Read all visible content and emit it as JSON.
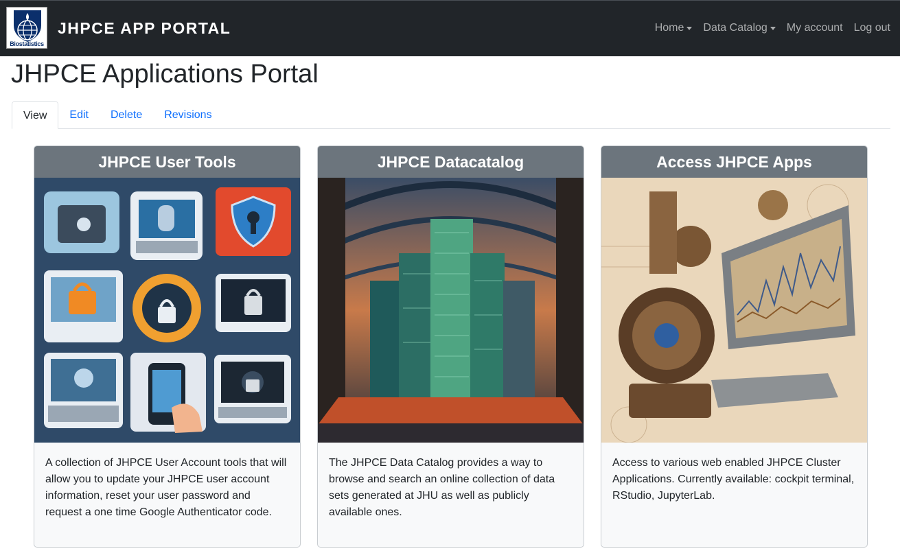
{
  "navbar": {
    "logo_text": "Biostatistics",
    "brand": "JHPCE APP PORTAL",
    "items": [
      {
        "label": "Home",
        "has_dropdown": true
      },
      {
        "label": "Data Catalog",
        "has_dropdown": true
      },
      {
        "label": "My account",
        "has_dropdown": false
      },
      {
        "label": "Log out",
        "has_dropdown": false
      }
    ]
  },
  "page": {
    "title": "JHPCE Applications Portal"
  },
  "tabs": [
    {
      "label": "View",
      "active": true
    },
    {
      "label": "Edit",
      "active": false
    },
    {
      "label": "Delete",
      "active": false
    },
    {
      "label": "Revisions",
      "active": false
    }
  ],
  "cards": [
    {
      "title": "JHPCE User Tools",
      "image": "user-tools-illustration",
      "text": "A collection of JHPCE User Account tools that will allow you to update your JHPCE user account information, reset your user password and request a one time Google Authenticator code."
    },
    {
      "title": "JHPCE Datacatalog",
      "image": "datacatalog-illustration",
      "text": "The JHPCE Data Catalog provides a way to browse and search an online collection of data sets generated at JHU as well as publicly available ones."
    },
    {
      "title": "Access JHPCE Apps",
      "image": "apps-illustration",
      "text": "Access to various web enabled JHPCE Cluster Applications. Currently available: cockpit terminal, RStudio, JupyterLab."
    }
  ],
  "colors": {
    "navbar_bg": "#212529",
    "card_header_bg": "#6c757d",
    "link": "#0d6efd"
  }
}
